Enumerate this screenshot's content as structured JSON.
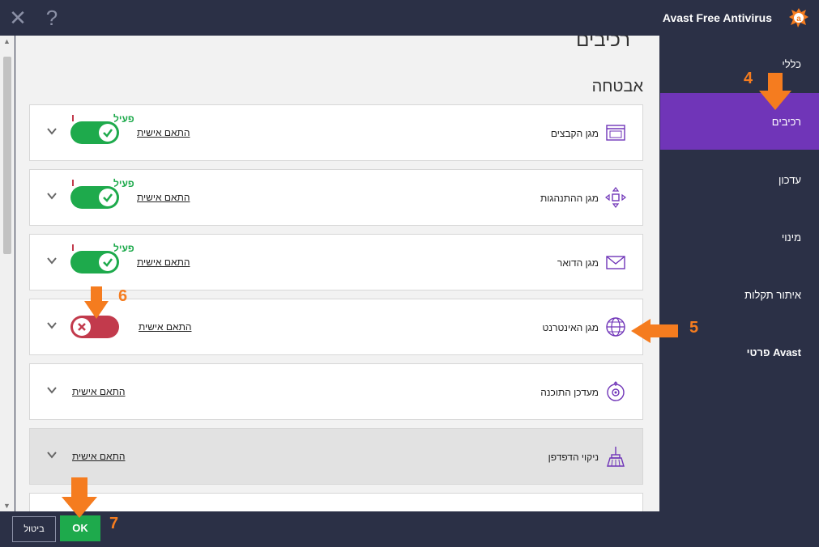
{
  "window": {
    "close_icon": "close-icon",
    "help_icon": "help-icon",
    "close_glyph": "✕",
    "help_glyph": "?",
    "title": "Avast Free Antivirus",
    "accent": "#f57c1f"
  },
  "sidebar": {
    "items": [
      {
        "label": "כללי"
      },
      {
        "label": "רכיבים"
      },
      {
        "label": "עדכון"
      },
      {
        "label": "מינוי"
      },
      {
        "label": "איתור תקלות"
      },
      {
        "label": "פרטי Avast"
      }
    ],
    "active_color": "#7035b8"
  },
  "main": {
    "page_title": "רכיבים",
    "section_title": "אבטחה",
    "customize_label": "התאם אישית",
    "on_label": "פעיל",
    "rows": [
      {
        "label": "מגן הקבצים",
        "icon": "file-window-icon",
        "state": "on"
      },
      {
        "label": "מגן ההתנהגות",
        "icon": "move-arrows-icon",
        "state": "on"
      },
      {
        "label": "מגן הדואר",
        "icon": "envelope-icon",
        "state": "on"
      },
      {
        "label": "מגן האינטרנט",
        "icon": "globe-icon",
        "state": "off"
      },
      {
        "label": "מעדכן התוכנה",
        "icon": "software-updater-icon",
        "state": "none"
      },
      {
        "label": "ניקוי הדפדפן",
        "icon": "broom-icon",
        "state": "none"
      }
    ]
  },
  "footer": {
    "cancel_label": "ביטול",
    "ok_label": "OK"
  },
  "annotations": {
    "n4": "4",
    "n5": "5",
    "n6": "6",
    "n7": "7"
  },
  "colors": {
    "dark_bg": "#2b3046",
    "toggle_on": "#1eaa4c",
    "toggle_off": "#c23a4c",
    "icon_purple": "#7035b8"
  }
}
